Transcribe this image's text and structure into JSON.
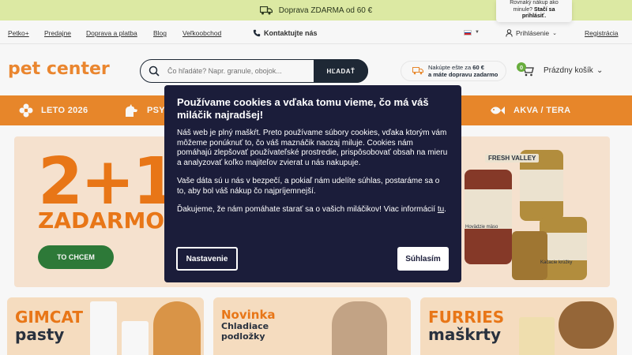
{
  "promo": {
    "text": "Doprava ZDARMA od 60 €",
    "icon": "truck-icon"
  },
  "tooltip": {
    "line1": "Rovnaký nákup ako",
    "line2_prefix": "minule? ",
    "line2_bold": "Stačí sa",
    "line3_bold": "prihlásiť."
  },
  "util_nav": {
    "links": [
      "Petko+",
      "Predajne",
      "Doprava a platba",
      "Blog",
      "Veľkoobchod"
    ],
    "contact": "Kontaktujte nás",
    "login": "Prihlásenie",
    "register": "Registrácia"
  },
  "header": {
    "logo": "pet center",
    "search_placeholder": "Čo hľadáte? Napr. granule, obojok...",
    "search_button": "HĽADAŤ",
    "free_ship_line1_prefix": "Nakúpte ešte za ",
    "free_ship_amount": "60 €",
    "free_ship_line2": "a máte dopravu zadarmo",
    "cart_count": "0",
    "cart_label": "Prázdny košík"
  },
  "categories": [
    "LETO 2026",
    "PSY",
    "AKVA / TERA"
  ],
  "hero": {
    "big": "2+1",
    "sub": "ZADARMO",
    "button": "TO CHCEM",
    "brand": "FRESH VALLEY",
    "can1": "Hovädzie mäso",
    "can2": "Kačacie krúžky"
  },
  "cards": [
    {
      "title": "GIMCAT",
      "sub": "pasty"
    },
    {
      "title": "Novinka",
      "sub": "Chladiace podložky"
    },
    {
      "title": "FURRIES",
      "sub": "maškrty"
    }
  ],
  "cookie": {
    "title": "Používame cookies a vďaka tomu vieme, čo má váš miláčik najradšej!",
    "p1": "Náš web je plný maškŕt. Preto používame súbory cookies, vďaka ktorým vám môžeme ponúknuť to, čo váš maznáčik naozaj miluje. Cookies nám pomáhajú zlepšovať používateľské prostredie, prispôsobovať obsah na mieru a analyzovať koľko majiteľov zvierat u nás nakupuje.",
    "p2": "Vaše dáta sú u nás v bezpečí, a pokiaľ nám udelíte súhlas, postaráme sa o to, aby bol váš nákup čo najpríjemnejší.",
    "p3_text": "Ďakujeme, že nám pomáhate starať sa o vašich miláčikov! Viac informácií ",
    "p3_link": "tu",
    "settings": "Nastavenie",
    "accept": "Súhlasím"
  },
  "colors": {
    "orange": "#ef8b2c",
    "navy": "#1b1d3a",
    "green": "#2f7d3a",
    "promo_bg": "#e4f1a9"
  }
}
